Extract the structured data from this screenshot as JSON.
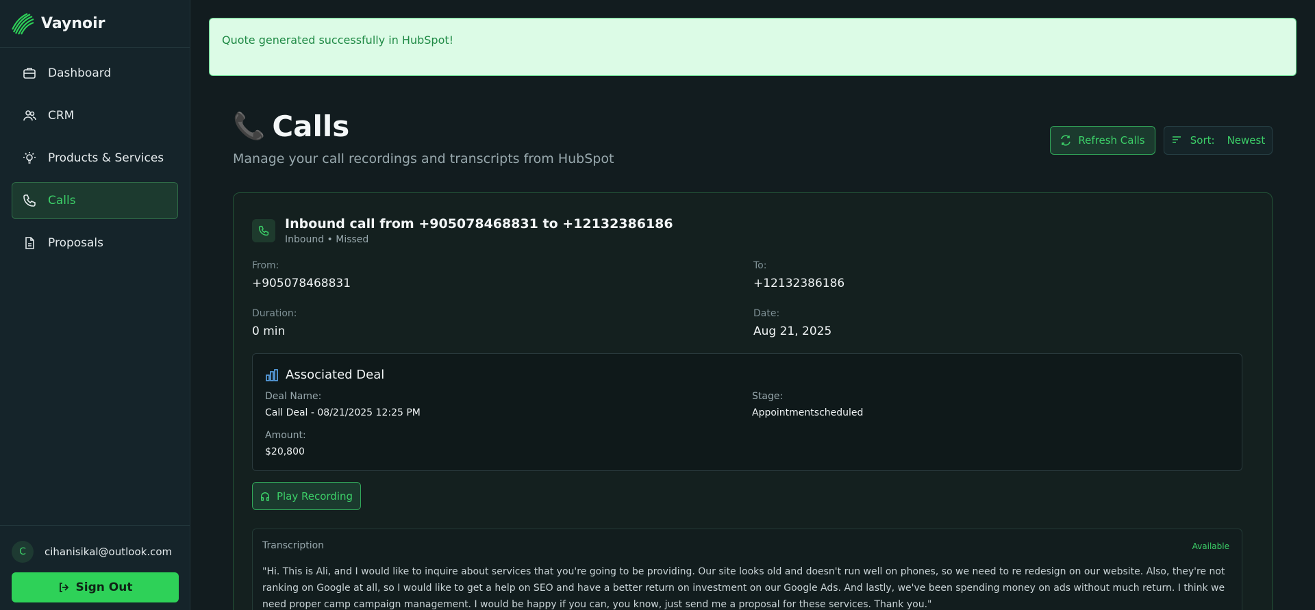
{
  "app": {
    "name": "Vaynoir"
  },
  "sidebar": {
    "items": [
      {
        "label": "Dashboard",
        "icon": "briefcase-icon"
      },
      {
        "label": "CRM",
        "icon": "users-icon"
      },
      {
        "label": "Products & Services",
        "icon": "lightbulb-icon"
      },
      {
        "label": "Calls",
        "icon": "phone-icon",
        "active": true
      },
      {
        "label": "Proposals",
        "icon": "document-icon"
      }
    ],
    "user": {
      "initial": "C",
      "email": "cihanisikal@outlook.com"
    },
    "signout_label": "Sign Out"
  },
  "toast": {
    "message": "Quote generated successfully in HubSpot!"
  },
  "header": {
    "title": "Calls",
    "title_icon": "📞",
    "subtitle": "Manage your call recordings and transcripts from HubSpot",
    "refresh_label": "Refresh Calls",
    "sort_label": "Sort:",
    "sort_value": "Newest"
  },
  "call": {
    "title": "Inbound call from +905078468831 to +12132386186",
    "meta": "Inbound • Missed",
    "from_label": "From:",
    "from": "+905078468831",
    "to_label": "To:",
    "to": "+12132386186",
    "duration_label": "Duration:",
    "duration": "0 min",
    "date_label": "Date:",
    "date": "Aug 21, 2025",
    "deal": {
      "title": "Associated Deal",
      "name_label": "Deal Name:",
      "name": "Call Deal - 08/21/2025 12:25 PM",
      "stage_label": "Stage:",
      "stage": "Appointmentscheduled",
      "amount_label": "Amount:",
      "amount": "$20,800"
    },
    "play_label": "Play Recording",
    "transcription": {
      "label": "Transcription",
      "status": "Available",
      "text": "\"Hi. This is Ali, and I would like to inquire about services that you're going to be providing. Our site looks old and doesn't run well on phones, so we need to re redesign on our website. Also, they're not ranking on Google at all, so I would like to get a help on SEO and have a better return on investment on our Google Ads. And lastly, we've been spending money on ads without much return. I think we need proper camp campaign management. I would be happy if you can, you know, just send me a proposal for these services. Thank you.\""
    }
  },
  "colors": {
    "accent": "#2ed158",
    "background": "#121c1f",
    "sidebar": "#15242a"
  }
}
